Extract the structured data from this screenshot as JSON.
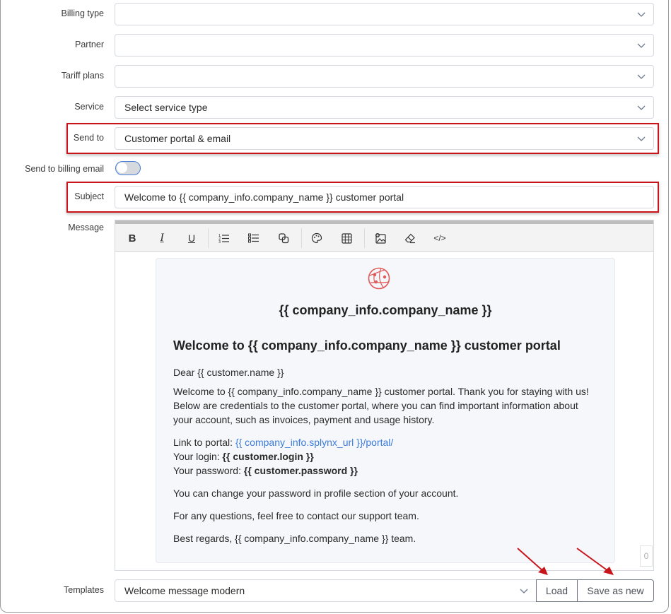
{
  "form": {
    "fields": [
      {
        "label": "Billing type",
        "value": ""
      },
      {
        "label": "Partner",
        "value": ""
      },
      {
        "label": "Tariff plans",
        "value": ""
      },
      {
        "label": "Service",
        "value": "Select service type"
      },
      {
        "label": "Send to",
        "value": "Customer portal & email"
      }
    ],
    "send_to_billing_email": {
      "label": "Send to billing email",
      "enabled": false
    },
    "subject": {
      "label": "Subject",
      "value": "Welcome to {{ company_info.company_name }} customer portal"
    },
    "message": {
      "label": "Message"
    }
  },
  "editor": {
    "toolbar": [
      {
        "icon": "bold-icon",
        "glyph": "B"
      },
      {
        "icon": "italic-icon",
        "glyph": "I"
      },
      {
        "icon": "underline-icon",
        "glyph": "U"
      },
      {
        "icon": "ordered-list-icon",
        "glyph": "1≡"
      },
      {
        "icon": "unordered-list-icon",
        "glyph": "•≡"
      },
      {
        "icon": "copy-icon",
        "glyph": "⧉"
      },
      {
        "icon": "palette-icon",
        "glyph": "🎨"
      },
      {
        "icon": "table-icon",
        "glyph": "▦"
      },
      {
        "icon": "insert-image-icon",
        "glyph": "🖼"
      },
      {
        "icon": "eraser-icon",
        "glyph": "⌫"
      },
      {
        "icon": "code-view-icon",
        "glyph": "</>"
      }
    ],
    "content": {
      "company_title": "{{ company_info.company_name }}",
      "heading": "Welcome to {{ company_info.company_name }} customer portal",
      "greeting": "Dear {{ customer.name }}",
      "intro": "Welcome to {{ company_info.company_name }} customer portal. Thank you for staying with us! Below are credentials to the customer portal, where you can find important information about your account, such as invoices, payment and usage history.",
      "link_label": "Link to portal: ",
      "link_value": "{{ company_info.splynx_url }}/portal/",
      "login_label": "Your login: ",
      "login_value": "{{ customer.login }}",
      "password_label": "Your password: ",
      "password_value": "{{ customer.password }}",
      "change_password": "You can change your password in profile section of your account.",
      "questions": "For any questions, feel free to contact our support team.",
      "regards": "Best regards, {{ company_info.company_name }} team."
    },
    "char_counter": "0"
  },
  "templates": {
    "label": "Templates",
    "selected": "Welcome message modern",
    "load_label": "Load",
    "save_as_new_label": "Save as new"
  },
  "colors": {
    "highlight": "#c8151b",
    "link": "#3b7bd9",
    "logo": "#e05a5a"
  }
}
